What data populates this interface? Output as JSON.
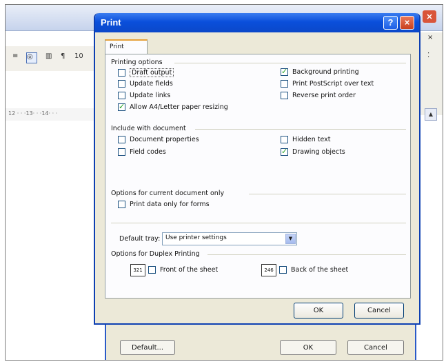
{
  "background": {
    "ruler_text": "12 · · ·13· · ·14· · ·",
    "toolbar_text": "10",
    "side_close": "×",
    "options_dialog": {
      "default_label": "Default...",
      "ok_label": "OK",
      "cancel_label": "Cancel"
    }
  },
  "dialog": {
    "title": "Print",
    "help_label": "?",
    "close_label": "×",
    "tab_label": "Print",
    "printing_options": {
      "heading": "Printing options",
      "left": [
        {
          "label": "Draft output",
          "checked": false
        },
        {
          "label": "Update fields",
          "checked": false
        },
        {
          "label": "Update links",
          "checked": false
        },
        {
          "label": "Allow A4/Letter paper resizing",
          "checked": true
        }
      ],
      "right": [
        {
          "label": "Background printing",
          "checked": true
        },
        {
          "label": "Print PostScript over text",
          "checked": false
        },
        {
          "label": "Reverse print order",
          "checked": false
        }
      ]
    },
    "include_with_document": {
      "heading": "Include with document",
      "left": [
        {
          "label": "Document properties",
          "checked": false
        },
        {
          "label": "Field codes",
          "checked": false
        }
      ],
      "right": [
        {
          "label": "Hidden text",
          "checked": false
        },
        {
          "label": "Drawing objects",
          "checked": true
        }
      ]
    },
    "current_document_options": {
      "heading": "Options for current document only",
      "items": [
        {
          "label": "Print data only for forms",
          "checked": false
        }
      ]
    },
    "default_tray": {
      "label": "Default tray:",
      "value": "Use printer settings"
    },
    "duplex": {
      "heading": "Options for Duplex Printing",
      "front_label": "Front of the sheet",
      "back_label": "Back of the sheet",
      "front_icon_text": "321",
      "back_icon_text": "246"
    },
    "ok_label": "OK",
    "cancel_label": "Cancel"
  }
}
